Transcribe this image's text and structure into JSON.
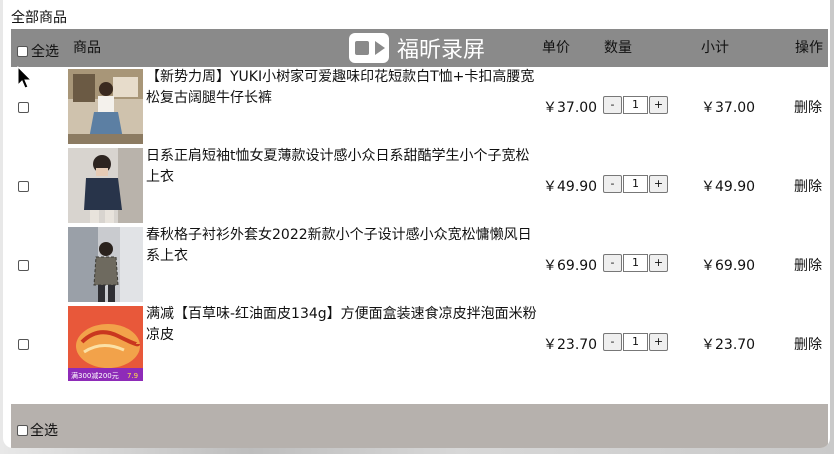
{
  "title": "全部商品",
  "header": {
    "select_all": "全选",
    "product": "商品",
    "unit_price": "单价",
    "quantity": "数量",
    "subtotal": "小计",
    "action": "操作"
  },
  "watermark": "福昕录屏",
  "rows": [
    {
      "name": "【新势力周】YUKI小树家可爱趣味印花短款白T恤+卡扣高腰宽松复古阔腿牛仔长裤",
      "price": "￥37.00",
      "qty": "1",
      "subtotal": "￥37.00",
      "delete": "删除"
    },
    {
      "name": "日系正肩短袖t恤女夏薄款设计感小众日系甜酷学生小个子宽松上衣",
      "price": "￥49.90",
      "qty": "1",
      "subtotal": "￥49.90",
      "delete": "删除"
    },
    {
      "name": "春秋格子衬衫外套女2022新款小个子设计感小众宽松慵懒风日系上衣",
      "price": "￥69.90",
      "qty": "1",
      "subtotal": "￥69.90",
      "delete": "删除"
    },
    {
      "name": "满减【百草味-红油面皮134g】方便面盒装速食凉皮拌泡面米粉凉皮",
      "price": "￥23.70",
      "qty": "1",
      "subtotal": "￥23.70",
      "delete": "删除"
    }
  ],
  "qty_minus": "-",
  "qty_plus": "+",
  "footer": {
    "select_all": "全选"
  },
  "thumb4_badge_text": "满300减200元",
  "thumb4_price_tag": "7.9"
}
